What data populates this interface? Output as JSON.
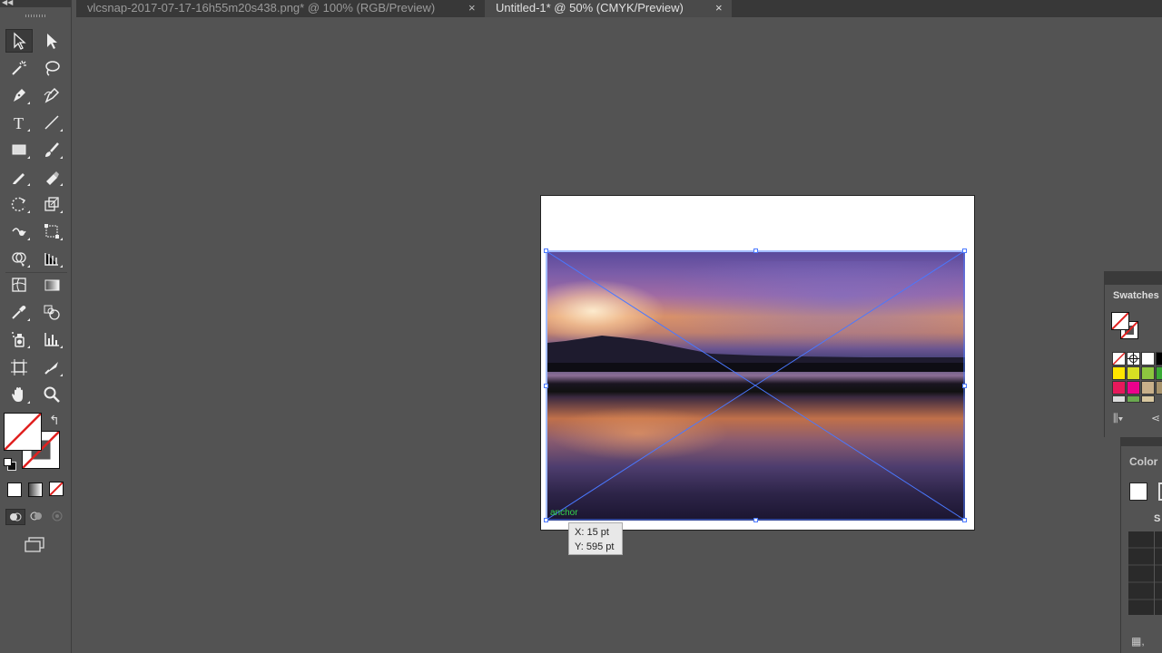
{
  "tabs": [
    {
      "label": "vlcsnap-2017-07-17-16h55m20s438.png* @ 100% (RGB/Preview)",
      "close": "×"
    },
    {
      "label": "Untitled-1* @ 50% (CMYK/Preview)",
      "close": "×"
    }
  ],
  "toolbar": {
    "tools": [
      "selection-tool",
      "direct-selection-tool",
      "magic-wand-tool",
      "lasso-tool",
      "pen-tool",
      "curvature-tool",
      "type-tool",
      "line-segment-tool",
      "rectangle-tool",
      "paintbrush-tool",
      "pencil-tool",
      "eraser-tool",
      "rotate-tool",
      "scale-tool",
      "warp-tool",
      "free-transform-tool",
      "shape-builder-tool",
      "perspective-grid-tool",
      "mesh-tool",
      "gradient-tool",
      "eyedropper-tool",
      "blend-tool",
      "symbol-sprayer-tool",
      "column-graph-tool",
      "artboard-tool",
      "slice-tool",
      "hand-tool",
      "zoom-tool"
    ]
  },
  "canvas": {
    "anchor_label": "anchor",
    "coord_x": "X: 15 pt",
    "coord_y": "Y: 595 pt"
  },
  "swatches_panel": {
    "title": "Swatches",
    "colors": [
      "#ffffff",
      "#000000",
      "#ffe600",
      "#d7df23",
      "#8dc63f",
      "#3aa935",
      "#e6195b",
      "#ec008c",
      "#c8b08a",
      "#a6926b"
    ]
  },
  "color_panel": {
    "title": "Color",
    "label_s": "S"
  },
  "colors": {
    "app_background": "#535353",
    "tab_bar": "#383838",
    "selection_blue": "#4a78ff",
    "anchor_green": "#34d34a"
  }
}
